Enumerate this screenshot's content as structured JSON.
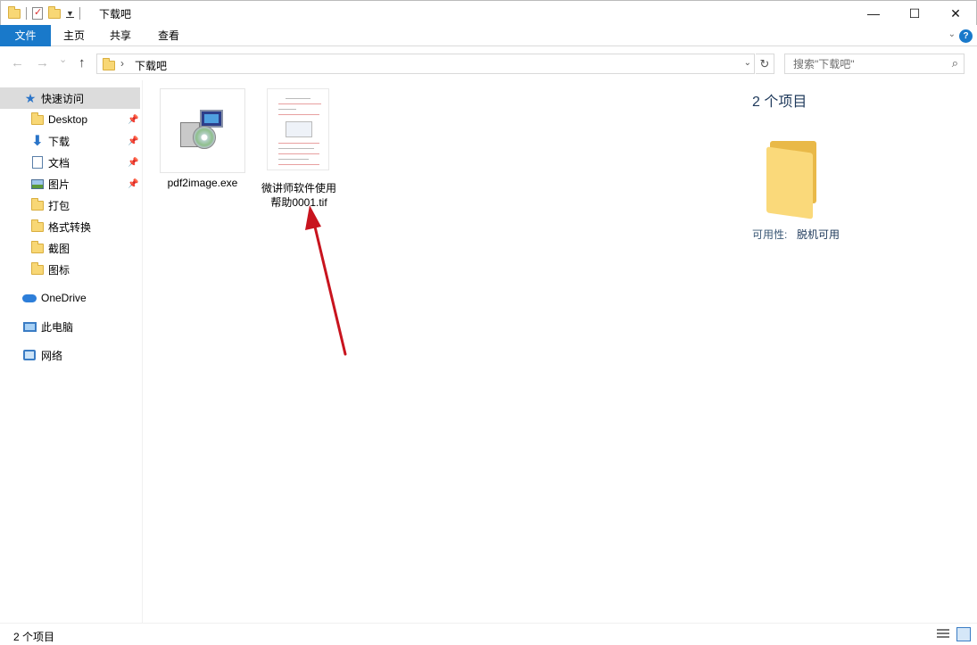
{
  "window": {
    "title": "下载吧",
    "controls": {
      "minimize": "—",
      "maximize": "☐",
      "close": "✕"
    }
  },
  "ribbon": {
    "tabs": [
      "文件",
      "主页",
      "共享",
      "查看"
    ],
    "help": "?"
  },
  "navbar": {
    "back": "←",
    "forward": "→",
    "recent": "⌄",
    "up": "↑",
    "breadcrumb_sep": "›",
    "breadcrumb": "下载吧",
    "refresh": "↻",
    "search_placeholder": "搜索\"下载吧\""
  },
  "sidebar": {
    "items": [
      {
        "label": "快速访问",
        "icon": "star-icon"
      },
      {
        "label": "Desktop",
        "icon": "folder-icon",
        "pinned": true
      },
      {
        "label": "下载",
        "icon": "download-icon",
        "pinned": true
      },
      {
        "label": "文档",
        "icon": "document-icon",
        "pinned": true
      },
      {
        "label": "图片",
        "icon": "pictures-icon",
        "pinned": true
      },
      {
        "label": "打包",
        "icon": "folder-icon"
      },
      {
        "label": "格式转换",
        "icon": "folder-icon"
      },
      {
        "label": "截图",
        "icon": "folder-icon"
      },
      {
        "label": "图标",
        "icon": "folder-icon"
      },
      {
        "label": "OneDrive",
        "icon": "onedrive-icon"
      },
      {
        "label": "此电脑",
        "icon": "this-pc-icon"
      },
      {
        "label": "网络",
        "icon": "network-icon"
      }
    ]
  },
  "files": [
    {
      "name": "pdf2image.exe",
      "icon": "installer-icon"
    },
    {
      "name_line1": "微讲师软件使用",
      "name_line2": "帮助0001.tif",
      "icon": "tif-thumbnail-icon"
    }
  ],
  "details": {
    "count": "2 个项目",
    "availability_label": "可用性:",
    "availability_value": "脱机可用"
  },
  "status": {
    "count": "2 个项目"
  },
  "annotation": {
    "color": "#c8141e"
  }
}
